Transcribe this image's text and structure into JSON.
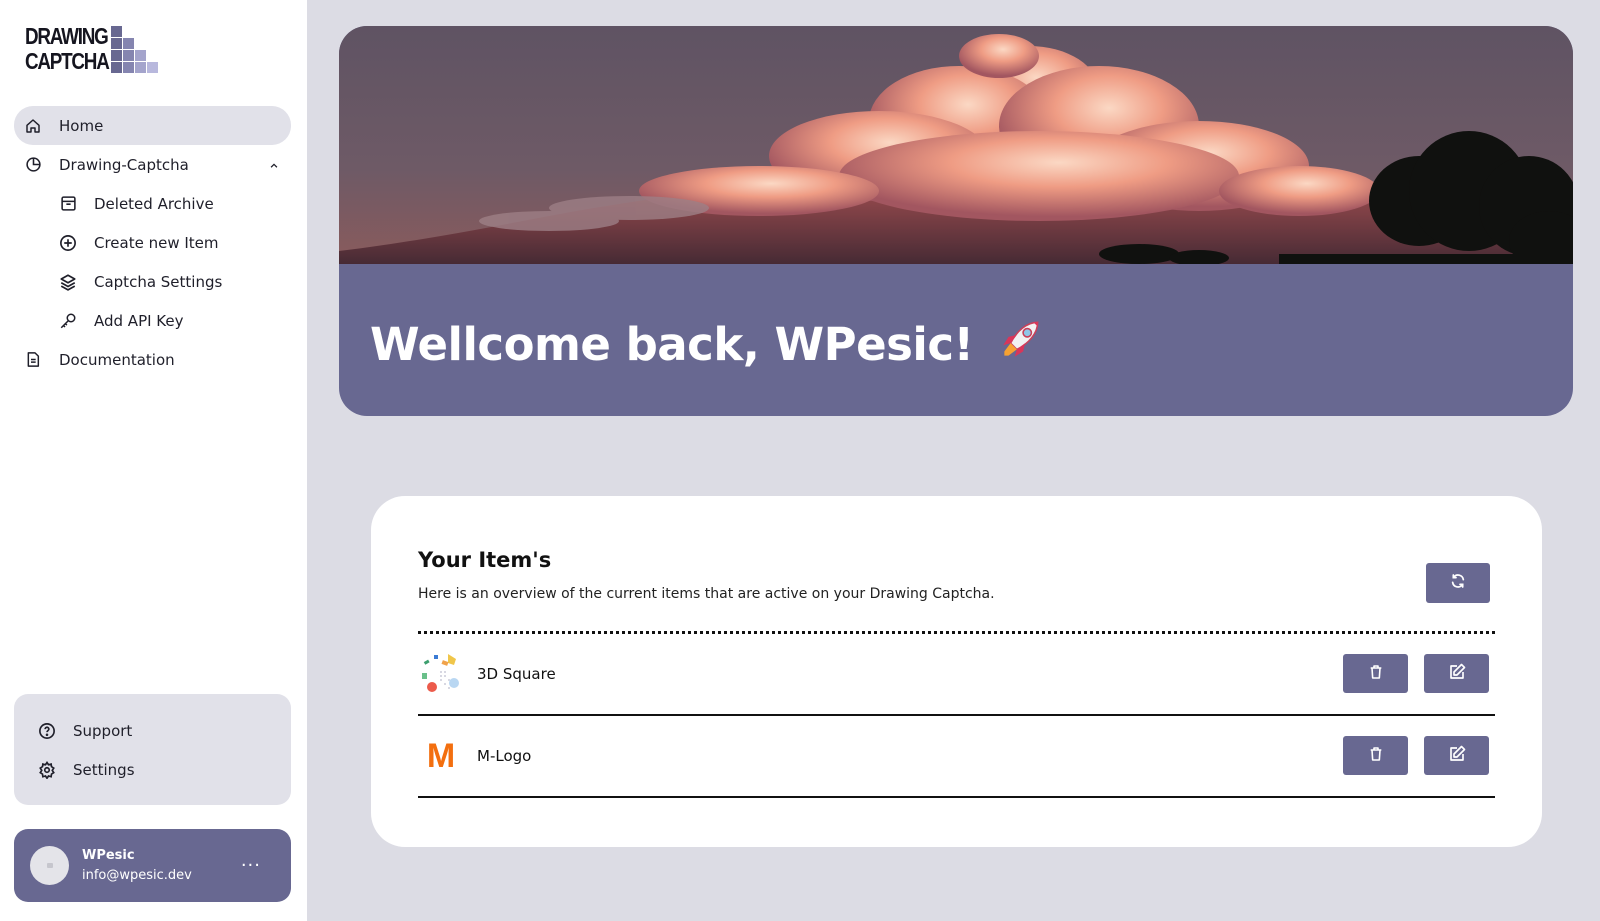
{
  "logo": {
    "line1": "DRAWING",
    "line2": "CAPTCHA"
  },
  "nav": {
    "home": {
      "label": "Home",
      "icon": "home-icon"
    },
    "drawing_captcha": {
      "label": "Drawing-Captcha",
      "icon": "pie-chart-icon"
    },
    "deleted_archive": {
      "label": "Deleted Archive",
      "icon": "archive-icon"
    },
    "create_new_item": {
      "label": "Create new Item",
      "icon": "plus-circle-icon"
    },
    "captcha_settings": {
      "label": "Captcha Settings",
      "icon": "layers-icon"
    },
    "add_api_key": {
      "label": "Add API Key",
      "icon": "key-icon"
    },
    "documentation": {
      "label": "Documentation",
      "icon": "document-icon"
    }
  },
  "support": {
    "support_label": "Support",
    "settings_label": "Settings"
  },
  "user": {
    "name": "WPesic",
    "email": "info@wpesic.dev",
    "more": "···"
  },
  "hero": {
    "title": "Wellcome back, WPesic!",
    "accent": "#686891"
  },
  "items": {
    "title": "Your Item's",
    "subtitle": "Here is an overview of the current items that are active on your Drawing Captcha.",
    "rows": [
      {
        "name": "3D Square"
      },
      {
        "name": "M-Logo",
        "thumb_text": "M"
      }
    ]
  },
  "colors": {
    "accent": "#686891",
    "background": "#dcdce4",
    "m_logo": "#f36f0f"
  }
}
